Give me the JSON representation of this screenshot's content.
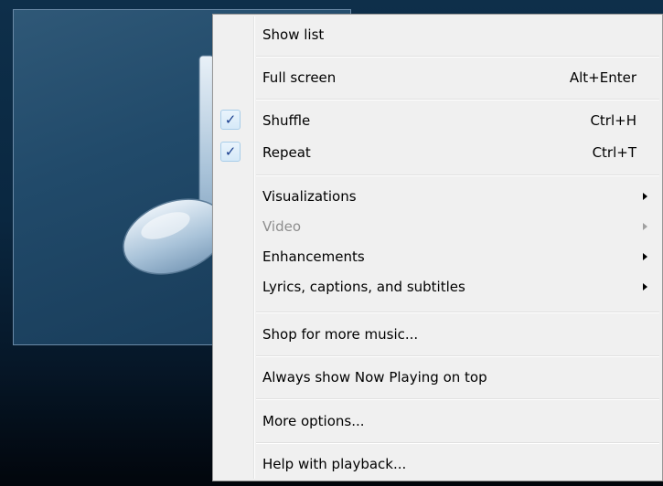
{
  "menu": {
    "show_list": {
      "label": "Show list"
    },
    "full_screen": {
      "label": "Full screen",
      "shortcut": "Alt+Enter"
    },
    "shuffle": {
      "label": "Shuffle",
      "shortcut": "Ctrl+H",
      "checked": true
    },
    "repeat": {
      "label": "Repeat",
      "shortcut": "Ctrl+T",
      "checked": true
    },
    "visualizations": {
      "label": "Visualizations"
    },
    "video": {
      "label": "Video",
      "disabled": true
    },
    "enhancements": {
      "label": "Enhancements"
    },
    "lyrics": {
      "label": "Lyrics, captions, and subtitles"
    },
    "shop": {
      "label": "Shop for more music..."
    },
    "always_on_top": {
      "label": "Always show Now Playing on top"
    },
    "more_options": {
      "label": "More options..."
    },
    "help_playback": {
      "label": "Help with playback..."
    }
  },
  "check_glyph": "✓",
  "icons": {
    "album_art": "music-note-icon",
    "submenu": "submenu-arrow-icon",
    "check": "checkmark-icon"
  },
  "colors": {
    "background": "#0a2740",
    "menu_bg": "#f0f0f0",
    "check_color": "#1a3f8f",
    "disabled_text": "#8d8d8d"
  }
}
